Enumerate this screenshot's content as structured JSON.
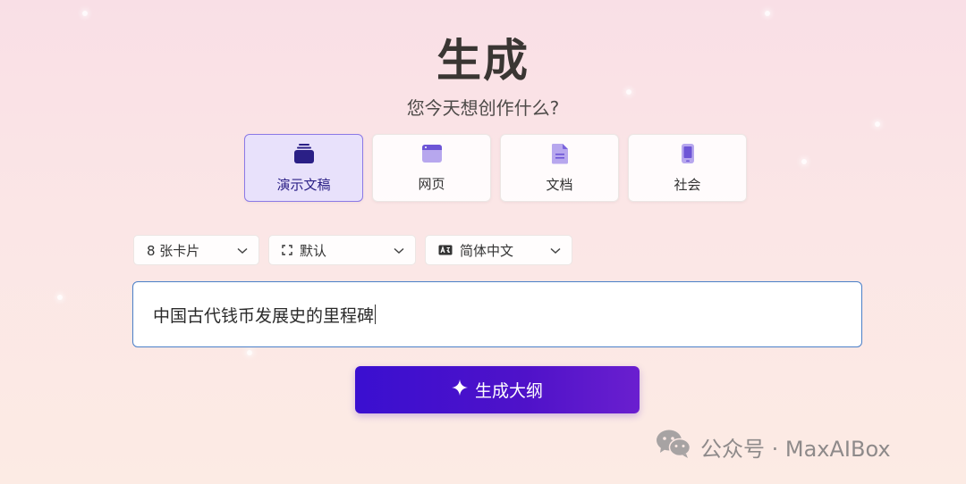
{
  "header": {
    "title": "生成",
    "subtitle": "您今天想创作什么?"
  },
  "content_types": [
    {
      "label": "演示文稿",
      "icon": "presentation-stack-icon",
      "selected": true
    },
    {
      "label": "网页",
      "icon": "webpage-icon",
      "selected": false
    },
    {
      "label": "文档",
      "icon": "document-icon",
      "selected": false
    },
    {
      "label": "社会",
      "icon": "mobile-phone-icon",
      "selected": false
    }
  ],
  "options": {
    "card_count": "8 张卡片",
    "layout": "默认",
    "language": "简体中文"
  },
  "prompt": {
    "value": "中国古代钱币发展史的里程碑"
  },
  "generate": {
    "label": "生成大纲",
    "icon": "sparkle-icon"
  },
  "watermark": {
    "text": "公众号 · MaxAIBox",
    "icon": "wechat-icon"
  },
  "colors": {
    "accent": "#3a0fd0",
    "selected_bg": "#e8e1fb",
    "selected_border": "#8b79e6",
    "input_border": "#4a7fc8"
  }
}
